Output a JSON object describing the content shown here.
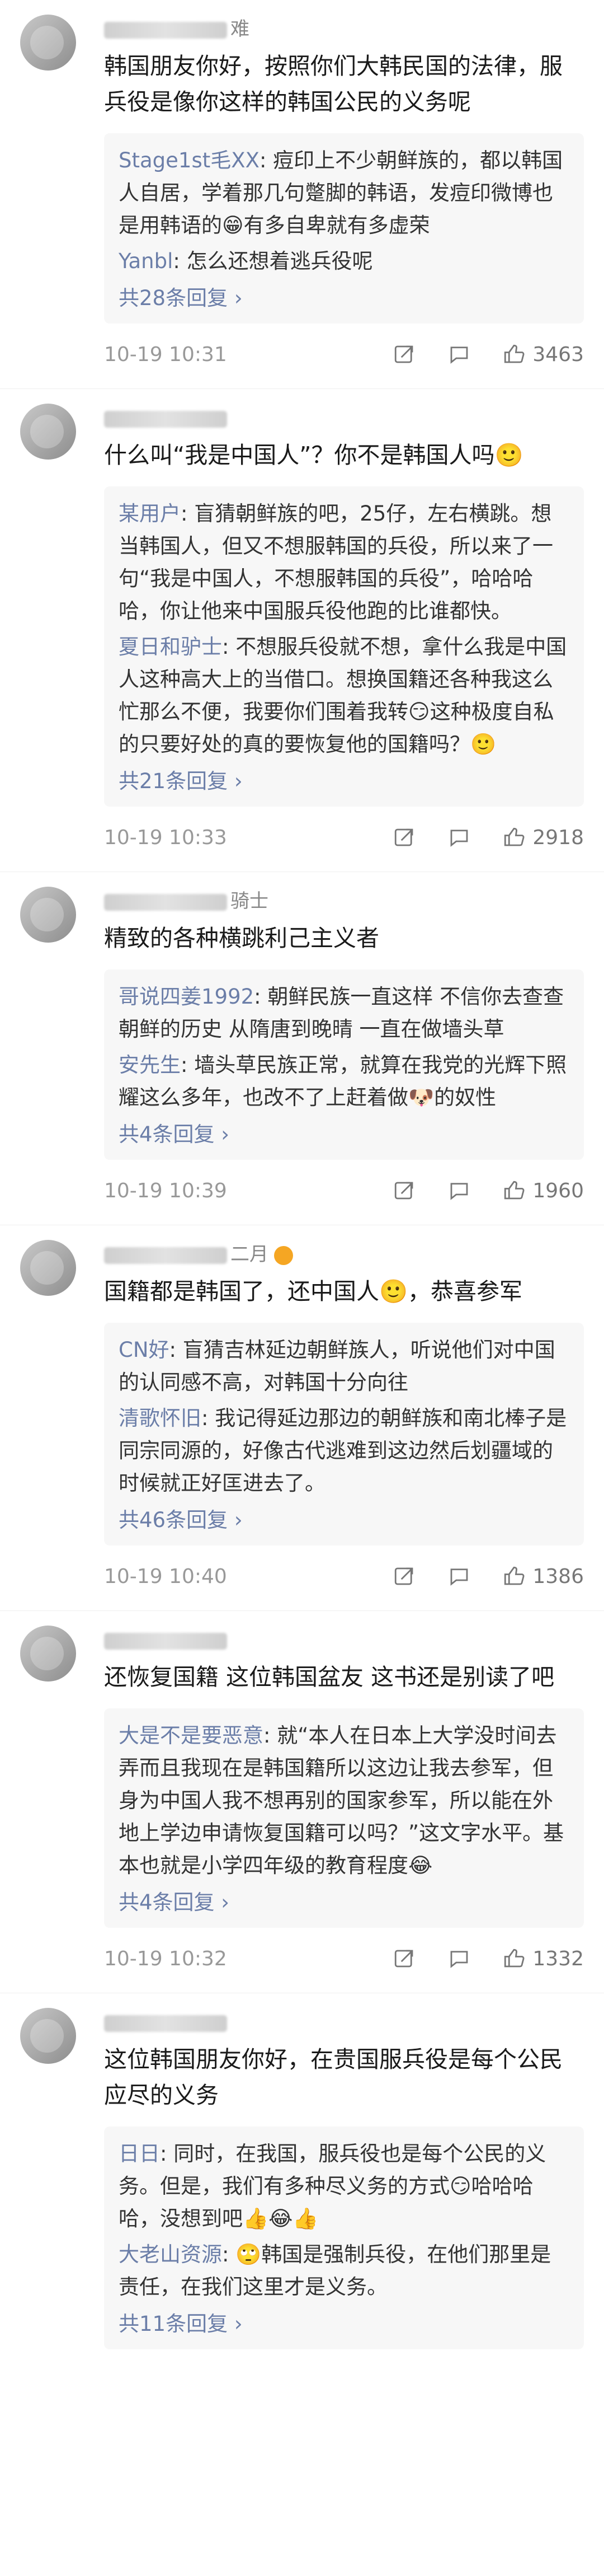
{
  "comments": [
    {
      "user_suffix": "难",
      "text": "韩国朋友你好，按照你们大韩民国的法律，服兵役是像你这样的韩国公民的义务呢",
      "replies": [
        {
          "name": "Stage1st毛XX",
          "text": "痘印上不少朝鲜族的，都以韩国人自居，学着那几句蹩脚的韩语，发痘印微博也是用韩语的😁有多自卑就有多虚荣"
        },
        {
          "name": "Yanbl",
          "text": "怎么还想着逃兵役呢"
        }
      ],
      "more": "共28条回复 ›",
      "time": "10-19 10:31",
      "likes": "3463"
    },
    {
      "user_suffix": "",
      "text": "什么叫“我是中国人”？你不是韩国人吗🙂",
      "replies": [
        {
          "name": "某用户",
          "text": "盲猜朝鲜族的吧，25仔，左右横跳。想当韩国人，但又不想服韩国的兵役，所以来了一句“我是中国人，不想服韩国的兵役”，哈哈哈哈，你让他来中国服兵役他跑的比谁都快。"
        },
        {
          "name": "夏日和驴士",
          "text": "不想服兵役就不想，拿什么我是中国人这种高大上的当借口。想换国籍还各种我这么忙那么不便，我要你们围着我转😏这种极度自私的只要好处的真的要恢复他的国籍吗？🙂"
        }
      ],
      "more": "共21条回复 ›",
      "time": "10-19 10:33",
      "likes": "2918"
    },
    {
      "user_suffix": "骑士",
      "text": "精致的各种横跳利己主义者",
      "replies": [
        {
          "name": "哥说四姜1992",
          "text": "朝鲜民族一直这样 不信你去查查朝鲜的历史 从隋唐到晚晴 一直在做墙头草"
        },
        {
          "name": "安先生",
          "text": "墙头草民族正常，就算在我党的光辉下照耀这么多年，也改不了上赶着做🐶的奴性"
        }
      ],
      "more": "共4条回复 ›",
      "time": "10-19 10:39",
      "likes": "1960"
    },
    {
      "user_suffix": "二月",
      "text": "国籍都是韩国了，还中国人🙂，恭喜参军",
      "replies": [
        {
          "name": "CN好",
          "text": "盲猜吉林延边朝鲜族人，听说他们对中国的认同感不高，对韩国十分向往"
        },
        {
          "name": "清歌怀旧",
          "text": "我记得延边那边的朝鲜族和南北棒子是同宗同源的，好像古代逃难到这边然后划疆域的时候就正好匡进去了。"
        }
      ],
      "more": "共46条回复 ›",
      "time": "10-19 10:40",
      "likes": "1386"
    },
    {
      "user_suffix": "",
      "text": "还恢复国籍 这位韩国盆友 这书还是别读了吧",
      "replies": [
        {
          "name": "大是不是要恶意",
          "text": "就“本人在日本上大学没时间去弄而且我现在是韩国籍所以这边让我去参军，但身为中国人我不想再别的国家参军，所以能在外地上学边申请恢复国籍可以吗？”这文字水平。基本也就是小学四年级的教育程度😂"
        }
      ],
      "more": "共4条回复 ›",
      "time": "10-19 10:32",
      "likes": "1332"
    },
    {
      "user_suffix": "",
      "text": "这位韩国朋友你好，在贵国服兵役是每个公民应尽的义务",
      "replies": [
        {
          "name": "日日",
          "text": "同时，在我国，服兵役也是每个公民的义务。但是，我们有多种尽义务的方式😏哈哈哈哈，没想到吧👍😂👍"
        },
        {
          "name": "大老山资源",
          "text": "🙄韩国是强制兵役，在他们那里是责任，在我们这里才是义务。"
        }
      ],
      "more": "共11条回复 ›",
      "time": "",
      "likes": ""
    }
  ]
}
